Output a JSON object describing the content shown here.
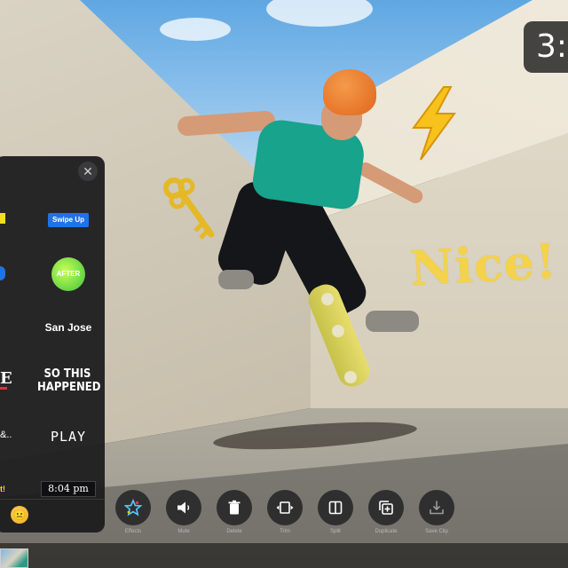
{
  "top_right_badge": "3:",
  "overlay_text": "Nice!",
  "sticker_panel": {
    "close_symbol": "✕",
    "stickers": {
      "swipe_up": "Swipe Up",
      "after": "AFTER",
      "san_jose": "San Jose",
      "clip_e": "E",
      "so_this_happened_line1": "SO THIS",
      "so_this_happened_line2": "HAPPENED",
      "play": "PLAY",
      "dots": "&..",
      "time": "8:04 pm",
      "exclaim": "t!"
    },
    "footer_emoji": "😐"
  },
  "toolbar": {
    "effects": "Effects",
    "mute": "Mute",
    "delete": "Delete",
    "trim": "Trim",
    "split": "Split",
    "duplicate": "Duplicate",
    "save_clip": "Save Clip"
  },
  "colors": {
    "sticker_yellow": "#f4d34b",
    "panel_bg": "#1c1c1e",
    "swipe_blue": "#1e73e8"
  }
}
